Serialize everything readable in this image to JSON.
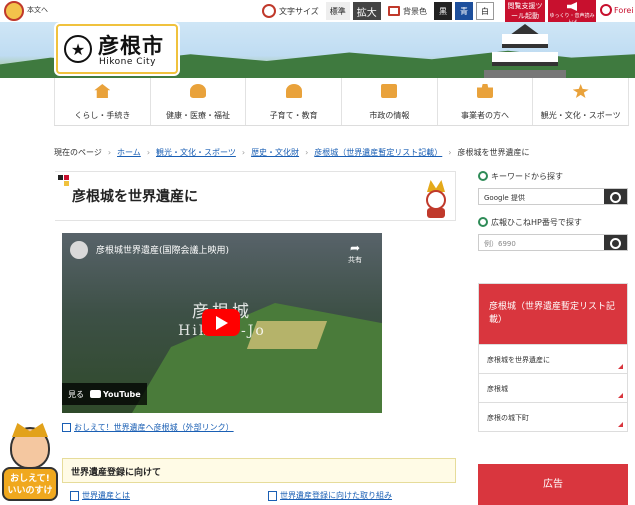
{
  "util": {
    "skip_label": "本文へ",
    "font_size_label": "文字サイズ",
    "standard_label": "標準",
    "enlarge_label": "拡大",
    "bg_label": "背景色",
    "bg_options": [
      "黒",
      "青",
      "白"
    ],
    "tool_label": "閲覧支援ツール起動",
    "voice_label": "ゆっくり・音声読み上げ",
    "lang_label": "Forei"
  },
  "header": {
    "logo_jp": "彦根市",
    "logo_en": "Hikone City"
  },
  "nav": {
    "items": [
      {
        "label": "くらし・手続き"
      },
      {
        "label": "健康・医療・福祉"
      },
      {
        "label": "子育て・教育"
      },
      {
        "label": "市政の情報"
      },
      {
        "label": "事業者の方へ"
      },
      {
        "label": "観光・文化・スポーツ"
      }
    ]
  },
  "breadcrumb": {
    "label": "現在のページ",
    "links": [
      "ホーム",
      "観光・文化・スポーツ",
      "歴史・文化財",
      "彦根城（世界遺産暫定リスト記載）"
    ],
    "current": "彦根城を世界遺産に"
  },
  "page": {
    "title": "彦根城を世界遺産に"
  },
  "video": {
    "title": "彦根城世界遺産(国際会議上映用)",
    "share_label": "共有",
    "overlay_line1": "彦根城",
    "overlay_line2": "Hikone-Jo",
    "watch_label": "見る",
    "platform": "YouTube"
  },
  "links": {
    "external": "おしえて！世界遺産へ彦根城（外部リンク）",
    "section_title": "世界遺産登録に向けて",
    "item1": "世界遺産とは",
    "item2": "世界遺産登録に向けた取り組み"
  },
  "mascot": {
    "line1": "おしえて!",
    "line2": "いいのすけ"
  },
  "sidebar": {
    "keyword_label": "キーワードから探す",
    "search_value": "Google 提供",
    "number_label": "広報ひこねHP番号で探す",
    "number_placeholder": "例）6990",
    "menu_head": "彦根城（世界遺産暫定リスト記載）",
    "menu_items": [
      "彦根城を世界遺産に",
      "彦根城",
      "彦根の城下町"
    ],
    "ad_label": "広告"
  },
  "colors": {
    "accent": "#d9363e",
    "link": "#1a5fb4",
    "logo_border": "#f0c23d"
  }
}
